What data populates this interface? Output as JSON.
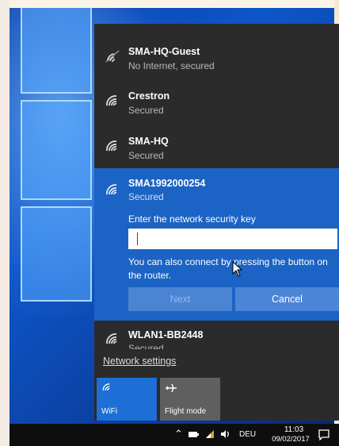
{
  "networks": [
    {
      "name": "SMA-HQ-Guest",
      "status": "No Internet, secured"
    },
    {
      "name": "Crestron",
      "status": "Secured"
    },
    {
      "name": "SMA-HQ",
      "status": "Secured"
    }
  ],
  "selected_network": {
    "name": "SMA1992000254",
    "status": "Secured",
    "key_label": "Enter the network security key",
    "key_value": "",
    "hint": "You can also connect by pressing the button on the router.",
    "next_label": "Next",
    "cancel_label": "Cancel"
  },
  "bottom_network": {
    "name": "WLAN1-BB2448",
    "status": "Secured"
  },
  "network_settings_label": "Network settings",
  "quick_actions": {
    "wifi_label": "WiFi",
    "flight_label": "Flight mode"
  },
  "taskbar": {
    "language": "DEU",
    "time": "11:03",
    "date": "09/02/2017"
  },
  "icons": [
    "wifi-icon",
    "airplane-icon",
    "chevron-up-icon",
    "network-icon",
    "volume-icon",
    "battery-icon",
    "action-center-icon"
  ],
  "colors": {
    "flyout_bg": "#2b2b2b",
    "selected_bg": "#1b63c4",
    "accent": "#1d6fd6"
  }
}
